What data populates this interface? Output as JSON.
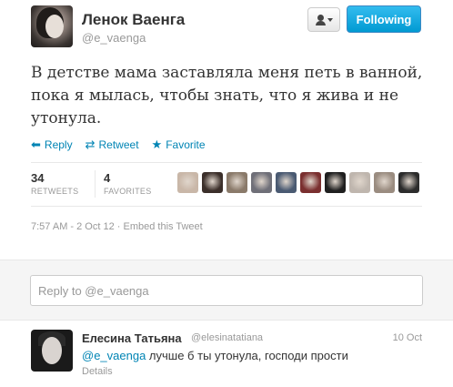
{
  "tweet": {
    "name": "Ленок Ваенга",
    "handle": "@e_vaenga",
    "follow_label": "Following",
    "text": "В детстве мама заставляла меня петь в ванной, пока я мылась, чтобы знать, что я жива и не утонула.",
    "actions": {
      "reply": "Reply",
      "retweet": "Retweet",
      "favorite": "Favorite"
    },
    "stats": {
      "retweets_count": "34",
      "retweets_label": "RETWEETS",
      "favorites_count": "4",
      "favorites_label": "FAVORITES"
    },
    "meta": "7:57 AM - 2 Oct 12 · Embed this Tweet",
    "favoriter_avatar_colors": [
      "#c9b7a8",
      "#3b2f2a",
      "#8a7a6a",
      "#6f6f78",
      "#4a5a72",
      "#7a2f2f",
      "#1f1f1f",
      "#bfb6ae",
      "#9a8c80",
      "#2c2c2c"
    ]
  },
  "reply_box": {
    "placeholder": "Reply to @e_vaenga"
  },
  "reply_tweet": {
    "name": "Елесина Татьяна",
    "handle": "@elesinatatiana",
    "time": "10 Oct",
    "mention": "@e_vaenga",
    "text": " лучше б ты утонула, господи прости",
    "details": "Details"
  },
  "colors": {
    "link": "#0084b4",
    "follow_button": "#019ad2",
    "muted": "#999999"
  }
}
